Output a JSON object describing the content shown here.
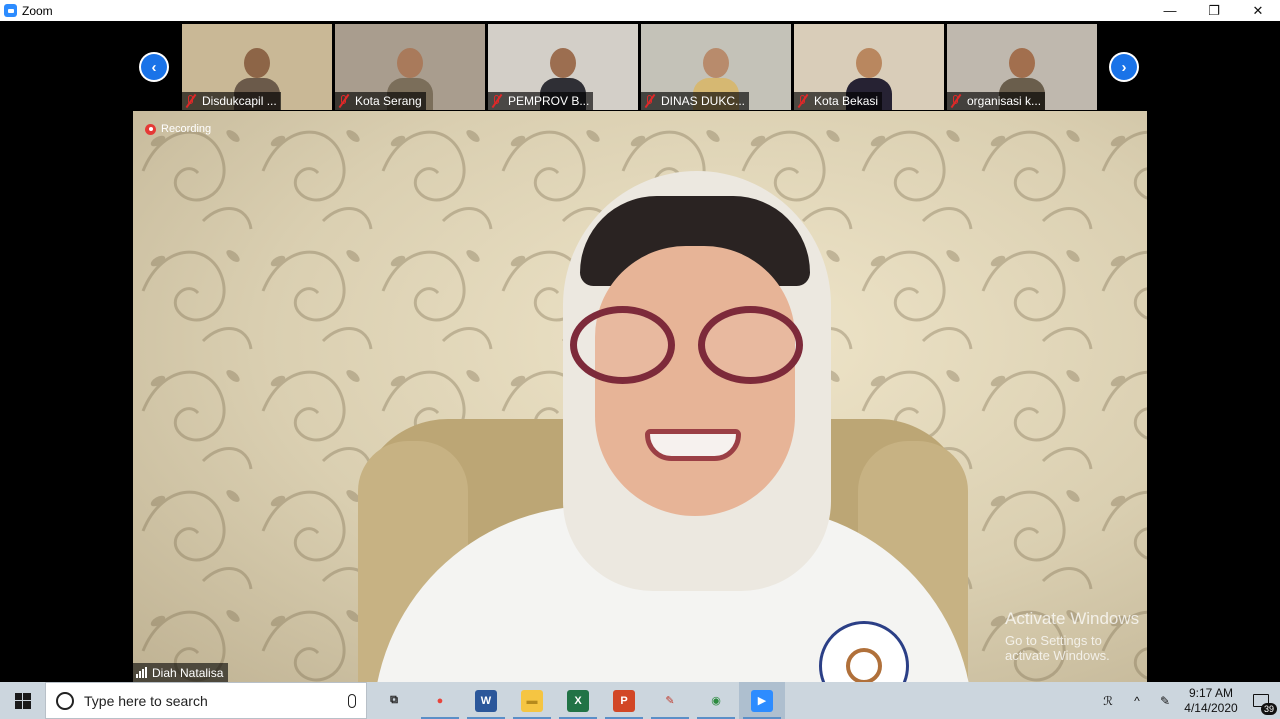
{
  "window": {
    "title": "Zoom",
    "controls": [
      "—",
      "❐",
      "✕"
    ]
  },
  "gallery": {
    "prev_glyph": "‹",
    "next_glyph": "›",
    "participants": [
      {
        "name": "Disdukcapil ...",
        "bg": "#c9b896",
        "skin": "#8d6547",
        "shirt": "#6b5a4a"
      },
      {
        "name": "Kota Serang",
        "bg": "#a99d8e",
        "skin": "#a97a5b",
        "shirt": "#7b6e5a"
      },
      {
        "name": "PEMPROV B...",
        "bg": "#d3cfc8",
        "skin": "#9c6e50",
        "shirt": "#2f2f35"
      },
      {
        "name": "DINAS DUKC...",
        "bg": "#c4c2b8",
        "skin": "#b88b6c",
        "shirt": "#d6b872"
      },
      {
        "name": "Kota Bekasi",
        "bg": "#d9cdb9",
        "skin": "#b9875f",
        "shirt": "#262233"
      },
      {
        "name": "organisasi k...",
        "bg": "#bfb8ae",
        "skin": "#a26f4e",
        "shirt": "#6a5e4c"
      }
    ]
  },
  "main_video": {
    "recording_label": "Recording",
    "speaker_name": "Diah Natalisa",
    "watermark_title": "Activate Windows",
    "watermark_subtitle": "Go to Settings to activate Windows."
  },
  "taskbar": {
    "search_placeholder": "Type here to search",
    "apps": [
      {
        "name": "task-view",
        "glyph": "⧉",
        "color": "#ccd6de",
        "text": "#222"
      },
      {
        "name": "chrome",
        "glyph": "●",
        "color": "#ccd6de",
        "text": "#e8453c"
      },
      {
        "name": "word",
        "glyph": "W",
        "color": "#2b579a",
        "text": "#fff"
      },
      {
        "name": "file-explorer",
        "glyph": "▬",
        "color": "#f5c542",
        "text": "#b58a1c"
      },
      {
        "name": "excel",
        "glyph": "X",
        "color": "#217346",
        "text": "#fff"
      },
      {
        "name": "powerpoint",
        "glyph": "P",
        "color": "#d24726",
        "text": "#fff"
      },
      {
        "name": "paint",
        "glyph": "✎",
        "color": "#ccd6de",
        "text": "#c0392b"
      },
      {
        "name": "browser",
        "glyph": "◉",
        "color": "#ccd6de",
        "text": "#2b8a3e"
      },
      {
        "name": "zoom",
        "glyph": "▶",
        "color": "#2d8cff",
        "text": "#fff"
      }
    ],
    "tray": {
      "people_glyph": "ℛ",
      "chevron_glyph": "^",
      "pen_glyph": "✎",
      "time": "9:17 AM",
      "date": "4/14/2020",
      "notification_count": "39"
    }
  }
}
